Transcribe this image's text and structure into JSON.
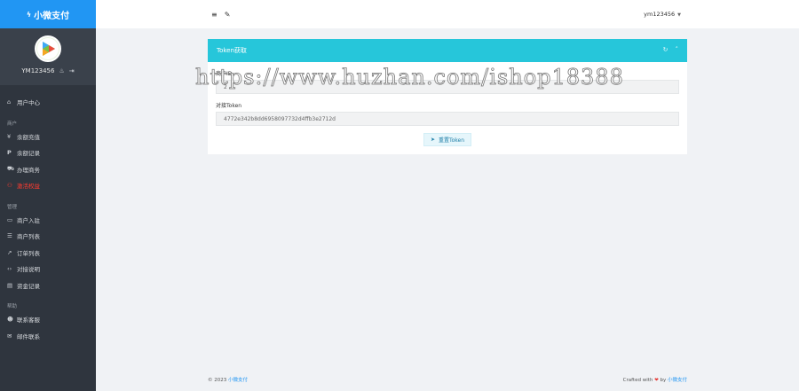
{
  "brand": {
    "icon": "bolt-icon",
    "title": "小微支付"
  },
  "profile": {
    "username": "YM123456",
    "icons": [
      "fire-icon",
      "logout-icon"
    ]
  },
  "nav": {
    "home": {
      "label": "用户中心",
      "icon": "home-icon"
    },
    "sections": [
      {
        "label": "商户",
        "items": [
          {
            "label": "余额充值",
            "icon": "yen-icon"
          },
          {
            "label": "余额记录",
            "icon": "p-icon"
          },
          {
            "label": "办理商务",
            "icon": "cart-icon"
          },
          {
            "label": "激活权益",
            "icon": "users-icon",
            "active": true,
            "color": "#ff3b30"
          }
        ]
      },
      {
        "label": "管理",
        "items": [
          {
            "label": "商户入驻",
            "icon": "folder-icon"
          },
          {
            "label": "商户列表",
            "icon": "list-icon"
          },
          {
            "label": "订单列表",
            "icon": "chart-icon"
          },
          {
            "label": "对接说明",
            "icon": "code-icon"
          },
          {
            "label": "资金记录",
            "icon": "card-icon"
          }
        ]
      },
      {
        "label": "帮助",
        "items": [
          {
            "label": "联系客服",
            "icon": "qq-icon"
          },
          {
            "label": "邮件联系",
            "icon": "mail-icon"
          }
        ]
      }
    ]
  },
  "topbar": {
    "menu_icon": "menu-icon",
    "tool_icon": "wrench-icon",
    "user": "ym123456"
  },
  "card": {
    "title": "Token获取",
    "tools": [
      "refresh-icon",
      "collapse-icon"
    ],
    "field1": {
      "label": "商户ID",
      "value": "2"
    },
    "field2": {
      "label": "对接Token",
      "value": "4772e342b8dd6958097732d4ffb3e2712d"
    },
    "button": "重置Token",
    "accent": "#26c6da"
  },
  "watermark": "https://www.huzhan.com/ishop18388",
  "footer": {
    "copyright": "© 2023",
    "brand_link": "小微支付",
    "crafted": "Crafted with",
    "by": "by",
    "author_link": "小微支付"
  }
}
